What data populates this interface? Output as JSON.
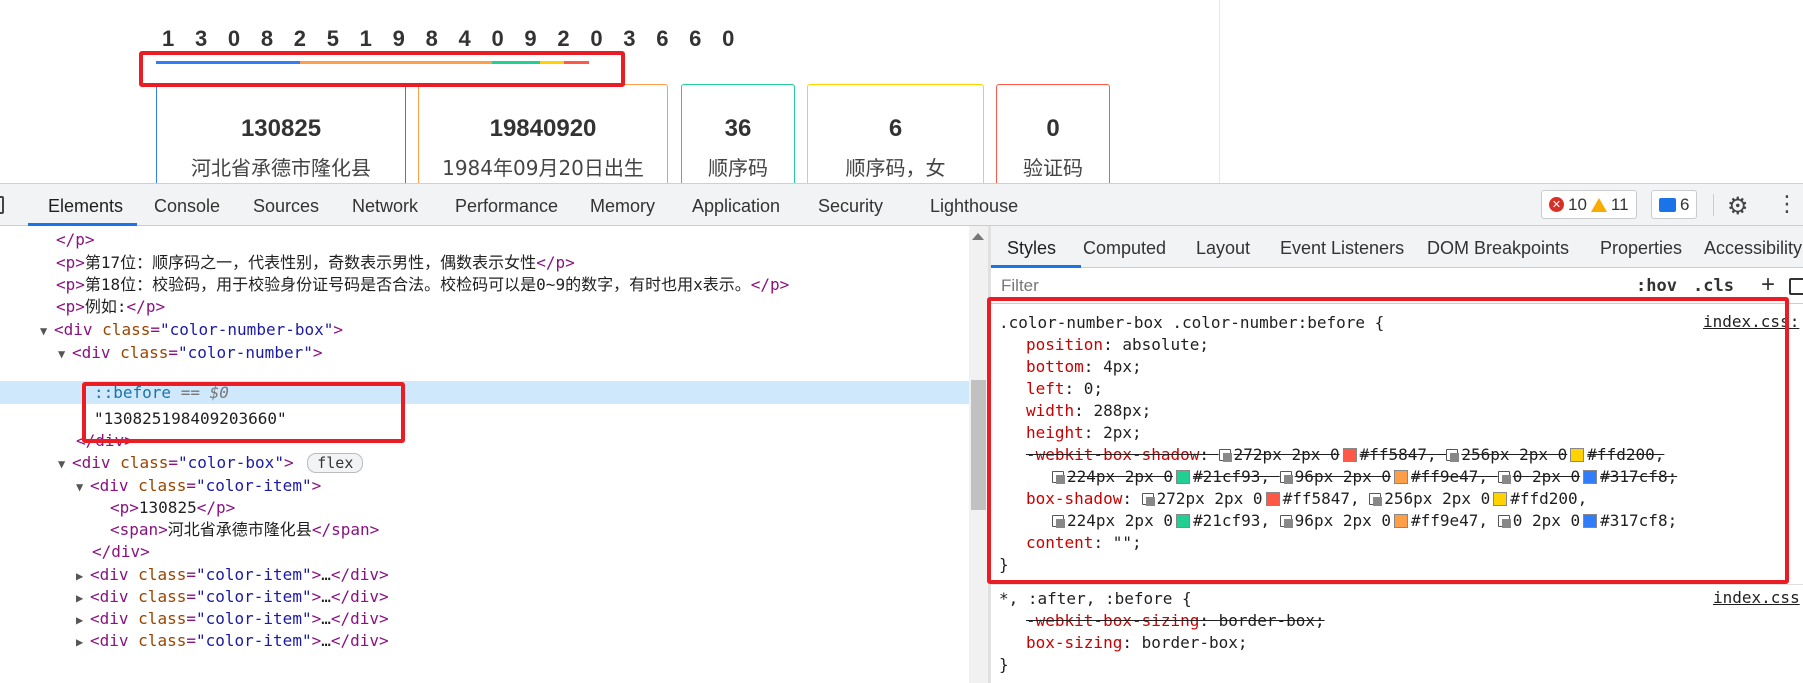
{
  "preview": {
    "digits": "1 3 0 8 2 5 1 9 8 4 0 9 2 0 3 6 6 0",
    "line_colors": [
      "#317cf8",
      "#ff9e47",
      "#21cf93",
      "#ffd200",
      "#ff5847"
    ],
    "cards": [
      {
        "num": "130825",
        "desc": "河北省承德市隆化县",
        "color": "#317cf8"
      },
      {
        "num": "19840920",
        "desc": "1984年09月20日出生",
        "color": "#ff9e47"
      },
      {
        "num": "36",
        "desc": "顺序码",
        "color": "#21cf93"
      },
      {
        "num": "6",
        "desc": "顺序码，女",
        "color": "#ffd200"
      },
      {
        "num": "0",
        "desc": "验证码",
        "color": "#ff5847"
      }
    ]
  },
  "devtools": {
    "tabs": [
      "Elements",
      "Console",
      "Sources",
      "Network",
      "Performance",
      "Memory",
      "Application",
      "Security",
      "Lighthouse"
    ],
    "errors": "10",
    "warnings": "11",
    "messages": "6"
  },
  "elements": {
    "line0": "</p>",
    "line1_text": "第17位：顺序码之一，代表性别，奇数表示男性，偶数表示女性",
    "line2_text": "第18位：校验码，用于校验身份证号码是否合法。校检码可以是0~9的数字，有时也用x表示。",
    "line3_text": "例如:",
    "color_number_box_class": "\"color-number-box\"",
    "color_number_class": "\"color-number\"",
    "pseudo": "::before",
    "pseudo_suffix": "== $0",
    "text_node": "\"130825198409203660\"",
    "close_div": "</div>",
    "color_box_class": "\"color-box\"",
    "flex_badge": "flex",
    "color_item_class": "\"color-item\"",
    "p_text": "130825",
    "span_text": "河北省承德市隆化县",
    "collapsed_inner": "…"
  },
  "styles": {
    "tabs": [
      "Styles",
      "Computed",
      "Layout",
      "Event Listeners",
      "DOM Breakpoints",
      "Properties",
      "Accessibility"
    ],
    "filter_placeholder": "Filter",
    "hov": ":hov",
    "cls": ".cls",
    "rule1": {
      "selector": ".color-number-box .color-number:before {",
      "source": "index.css:",
      "position": "absolute;",
      "bottom": "4px;",
      "left": "0;",
      "width": "288px;",
      "height": "2px;",
      "webkit_box_shadow_name": "-webkit-box-shadow",
      "box_shadow_name": "box-shadow",
      "shadow": {
        "s1": "272px 2px 0",
        "c1": "#ff5847,",
        "s2": "256px 2px 0",
        "c2": "#ffd200,",
        "s3": "224px 2px 0",
        "c3": "#21cf93,",
        "s4": "96px 2px 0",
        "c4": "#ff9e47,",
        "s5": "0 2px 0",
        "c5_webkit": "#317cf8;",
        "c5": "#317cf8;"
      },
      "content": "\"\";",
      "close": "}"
    },
    "rule2": {
      "selector": "*, :after, :before {",
      "source": "index.css",
      "webkit_box_sizing": "-webkit-box-sizing",
      "box_sizing": "box-sizing",
      "value": "border-box;",
      "close": "}"
    }
  }
}
